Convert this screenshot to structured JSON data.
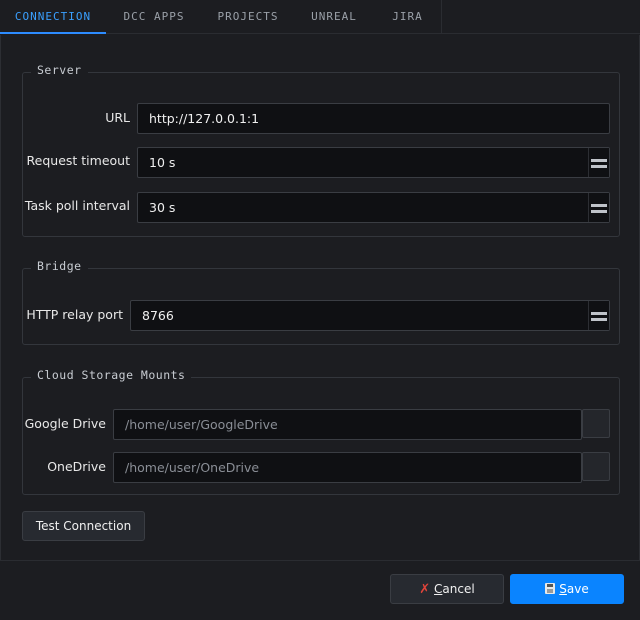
{
  "tabs": [
    {
      "label": "CONNECTION",
      "active": true
    },
    {
      "label": "DCC APPS"
    },
    {
      "label": "PROJECTS"
    },
    {
      "label": "UNREAL"
    },
    {
      "label": "JIRA"
    }
  ],
  "server": {
    "title": "Server",
    "url_label": "URL",
    "url_value": "http://127.0.0.1:1",
    "timeout_label": "Request timeout",
    "timeout_value": "10 s",
    "poll_label": "Task poll interval",
    "poll_value": "30 s"
  },
  "bridge": {
    "title": "Bridge",
    "relay_label": "HTTP relay port",
    "relay_value": "8766"
  },
  "cloud": {
    "title": "Cloud Storage Mounts",
    "gdrive_label": "Google Drive",
    "gdrive_placeholder": "/home/user/GoogleDrive",
    "onedrive_label": "OneDrive",
    "onedrive_placeholder": "/home/user/OneDrive"
  },
  "buttons": {
    "test": "Test Connection",
    "cancel_accel": "C",
    "cancel_rest": "ancel",
    "save_accel": "S",
    "save_rest": "ave"
  },
  "colors": {
    "accent": "#0a84ff",
    "active_tab": "#3aa0ff",
    "cancel_icon": "#e0443a"
  },
  "icons": {
    "cancel": "x-icon",
    "save": "floppy-disk-icon"
  }
}
